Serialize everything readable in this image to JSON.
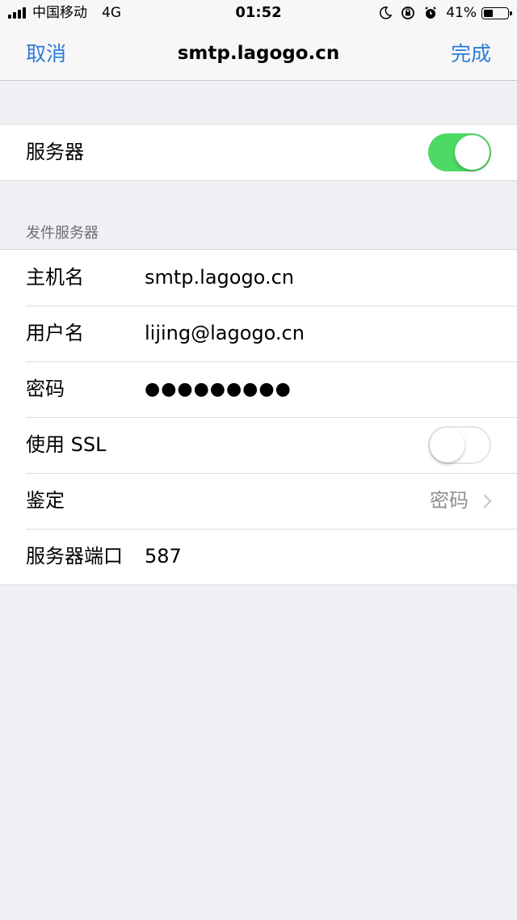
{
  "status_bar": {
    "carrier": "中国移动",
    "network": "4G",
    "time": "01:52",
    "battery_percent": "41%",
    "battery_level": 0.41,
    "icons": [
      "moon-icon",
      "orientation-lock-icon",
      "alarm-icon",
      "battery-icon"
    ]
  },
  "nav": {
    "cancel_label": "取消",
    "title": "smtp.lagogo.cn",
    "done_label": "完成"
  },
  "server_group": {
    "label": "服务器",
    "enabled": true
  },
  "outgoing": {
    "header": "发件服务器",
    "host_label": "主机名",
    "host_value": "smtp.lagogo.cn",
    "user_label": "用户名",
    "user_value": "lijing@lagogo.cn",
    "password_label": "密码",
    "password_value": "●●●●●●●●●",
    "ssl_label": "使用 SSL",
    "ssl_enabled": false,
    "auth_label": "鉴定",
    "auth_value": "密码",
    "port_label": "服务器端口",
    "port_value": "587"
  },
  "colors": {
    "accent": "#2f7bd8",
    "toggle_on": "#4cd964",
    "background": "#efeff4"
  }
}
